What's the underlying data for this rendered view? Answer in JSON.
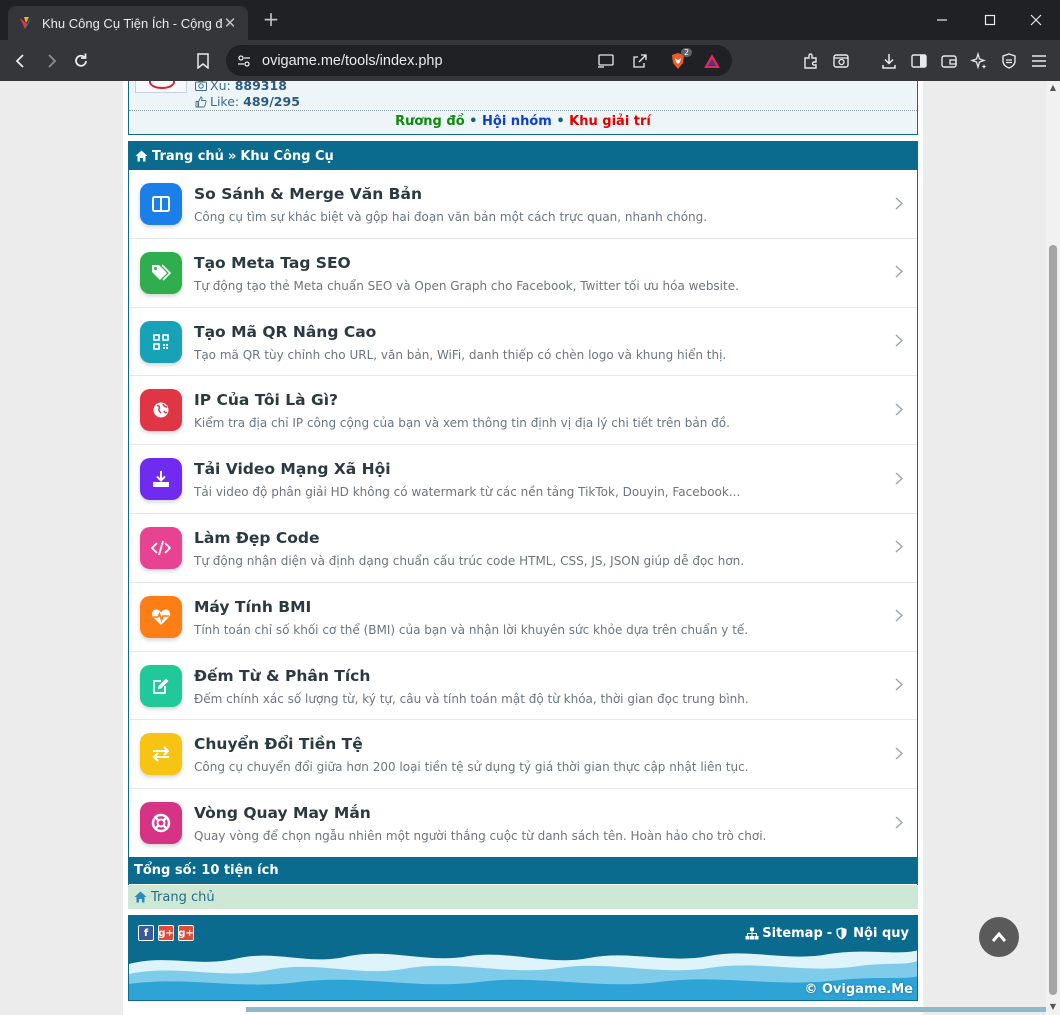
{
  "browser": {
    "tab_title": "Khu Công Cụ Tiện Ích - Cộng đồ",
    "new_tab": "+",
    "url": "ovigame.me/tools/index.php",
    "shields_count": "2"
  },
  "userbox": {
    "xu_label": "Xu:",
    "xu_value": "889318",
    "like_label": "Like:",
    "like_value": "489/295",
    "links": [
      "Rương đồ",
      "Hội nhóm",
      "Khu giải trí"
    ],
    "separator": "•"
  },
  "breadcrumb": {
    "home": "Trang chủ",
    "separator": "»",
    "current": "Khu Công Cụ"
  },
  "tools": [
    {
      "title": "So Sánh & Merge Văn Bản",
      "desc": "Công cụ tìm sự khác biệt và gộp hai đoạn văn bản một cách trực quan, nhanh chóng.",
      "color": "#1a7fe8",
      "icon": "columns-icon"
    },
    {
      "title": "Tạo Meta Tag SEO",
      "desc": "Tự động tạo thẻ Meta chuẩn SEO và Open Graph cho Facebook, Twitter tối ưu hóa website.",
      "color": "#2fae4e",
      "icon": "tags-icon"
    },
    {
      "title": "Tạo Mã QR Nâng Cao",
      "desc": "Tạo mã QR tùy chỉnh cho URL, văn bản, WiFi, danh thiếp có chèn logo và khung hiển thị.",
      "color": "#17a2b8",
      "icon": "qrcode-icon"
    },
    {
      "title": "IP Của Tôi Là Gì?",
      "desc": "Kiểm tra địa chỉ IP công cộng của bạn và xem thông tin định vị địa lý chi tiết trên bản đồ.",
      "color": "#e03545",
      "icon": "globe-icon"
    },
    {
      "title": "Tải Video Mạng Xã Hội",
      "desc": "Tải video độ phân giải HD không có watermark từ các nền tảng TikTok, Douyin, Facebook...",
      "color": "#6f2bf0",
      "icon": "download-icon"
    },
    {
      "title": "Làm Đẹp Code",
      "desc": "Tự động nhận diện và định dạng chuẩn cấu trúc code HTML, CSS, JS, JSON giúp dễ đọc hơn.",
      "color": "#e84393",
      "icon": "code-icon"
    },
    {
      "title": "Máy Tính BMI",
      "desc": "Tính toán chỉ số khối cơ thể (BMI) của bạn và nhận lời khuyên sức khỏe dựa trên chuẩn y tế.",
      "color": "#fd7e14",
      "icon": "heartbeat-icon"
    },
    {
      "title": "Đếm Từ & Phân Tích",
      "desc": "Đếm chính xác số lượng từ, ký tự, câu và tính toán mật độ từ khóa, thời gian đọc trung bình.",
      "color": "#20c997",
      "icon": "edit-icon"
    },
    {
      "title": "Chuyển Đổi Tiền Tệ",
      "desc": "Công cụ chuyển đổi giữa hơn 200 loại tiền tệ sử dụng tỷ giá thời gian thực cập nhật liên tục.",
      "color": "#f7c413",
      "icon": "exchange-icon"
    },
    {
      "title": "Vòng Quay May Mắn",
      "desc": "Quay vòng để chọn ngẫu nhiên một người thắng cuộc từ danh sách tên. Hoàn hảo cho trò chơi.",
      "color": "#d63384",
      "icon": "lifering-icon"
    }
  ],
  "total": "Tổng số: 10 tiện ích",
  "home_link": "Trang chủ",
  "footer": {
    "sitemap": "Sitemap",
    "dash": "-",
    "rules": "Nội quy",
    "copyright": "© Ovigame.Me",
    "social": [
      "f",
      "g+",
      "g+"
    ]
  }
}
